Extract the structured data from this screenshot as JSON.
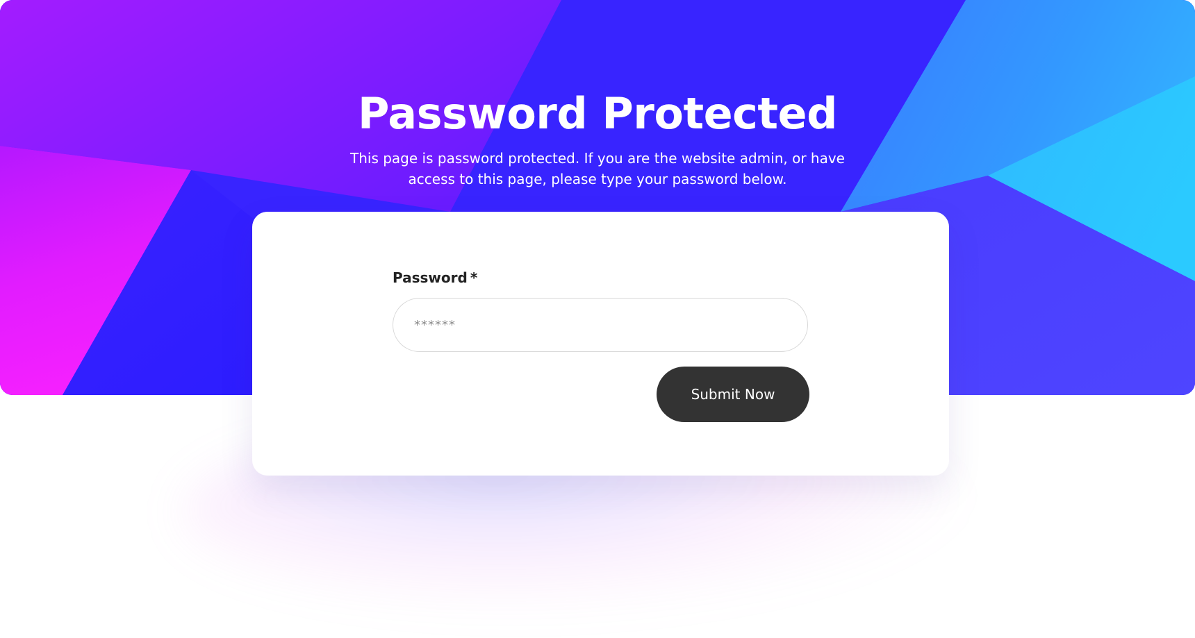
{
  "page": {
    "title": "Password Protected",
    "description": "This page is password protected. If you are the website admin, or have access to this page, please type your password below."
  },
  "form": {
    "password_label": "Password",
    "required_marker": "*",
    "password_placeholder": "******",
    "password_value": "",
    "submit_label": "Submit Now"
  },
  "colors": {
    "hero_base": "#3824ff",
    "magenta": "#f31cff",
    "cyan": "#2ac8ff",
    "button": "#333333",
    "card": "#ffffff"
  }
}
